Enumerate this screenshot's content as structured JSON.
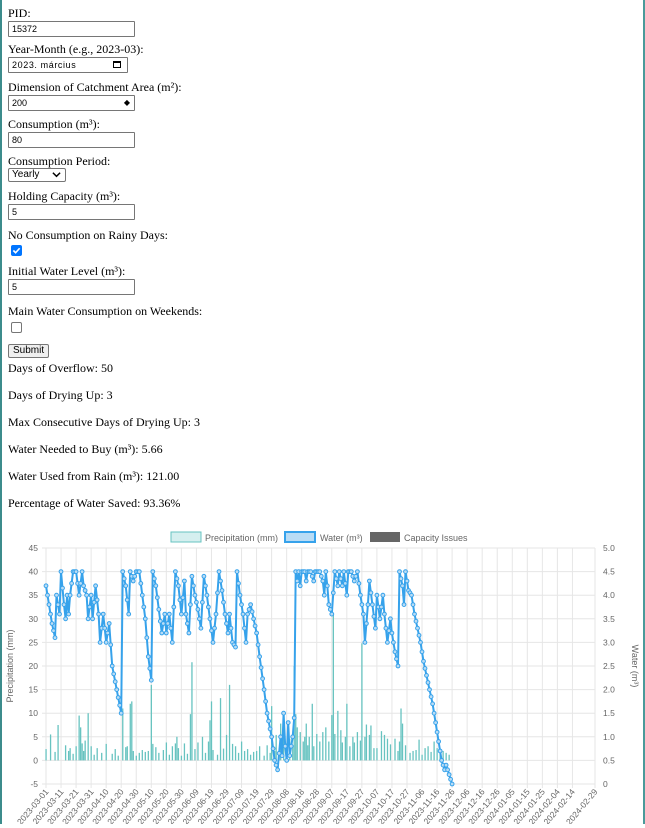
{
  "form": {
    "pid_label": "PID:",
    "pid_value": "15372",
    "yearmonth_label": "Year-Month (e.g., 2023-03):",
    "yearmonth_value": "2023. március",
    "catchment_label": "Dimension of Catchment Area (m²):",
    "catchment_value": "200",
    "consumption_label": "Consumption (m³):",
    "consumption_value": "80",
    "period_label": "Consumption Period:",
    "period_value": "Yearly",
    "holding_label": "Holding Capacity (m³):",
    "holding_value": "5",
    "rainy_label": "No Consumption on Rainy Days:",
    "rainy_checked": true,
    "initial_label": "Initial Water Level (m³):",
    "initial_value": "5",
    "weekend_label": "Main Water Consumption on Weekends:",
    "weekend_checked": false,
    "submit_label": "Submit"
  },
  "results": [
    "Days of Overflow: 50",
    "Days of Drying Up: 3",
    "Max Consecutive Days of Drying Up: 3",
    "Water Needed to Buy (m³): 5.66",
    "Water Used from Rain (m³): 121.00",
    "Percentage of Water Saved: 93.36%"
  ],
  "colors": {
    "precip_fill": "#d5efef",
    "precip_bar": "#67c3c0",
    "water_line": "#36a2eb",
    "water_fill": "#b9dcf5",
    "capacity": "#666666",
    "grid": "#e6e6e6"
  },
  "chart_data": {
    "type": "bar+line",
    "legend": [
      "Precipitation (mm)",
      "Water (m³)",
      "Capacity Issues"
    ],
    "legend_position": "top",
    "ylabel_left": "Precipitation (mm)",
    "ylabel_right": "Water (m³)",
    "ylim_left": [
      -5,
      45
    ],
    "ylim_right": [
      0,
      5
    ],
    "yticks_left": [
      "45",
      "40",
      "35",
      "30",
      "25",
      "20",
      "15",
      "10",
      "5",
      "0",
      "-5"
    ],
    "yticks_right": [
      "5.0",
      "4.5",
      "4.0",
      "3.5",
      "3.0",
      "2.5",
      "2.0",
      "1.5",
      "1.0",
      "0.5",
      "0"
    ],
    "x_start": "2023-03-01",
    "x_end": "2024-02-29",
    "xticks": [
      "2023-03-01",
      "2023-03-11",
      "2023-03-21",
      "2023-03-31",
      "2023-04-10",
      "2023-04-20",
      "2023-04-30",
      "2023-05-10",
      "2023-05-20",
      "2023-05-30",
      "2023-06-09",
      "2023-06-19",
      "2023-06-29",
      "2023-07-09",
      "2023-07-19",
      "2023-07-29",
      "2023-08-08",
      "2023-08-18",
      "2023-08-28",
      "2023-09-07",
      "2023-09-17",
      "2023-09-27",
      "2023-10-07",
      "2023-10-17",
      "2023-10-27",
      "2023-11-06",
      "2023-11-16",
      "2023-11-26",
      "2023-12-06",
      "2023-12-16",
      "2023-12-26",
      "2024-01-05",
      "2024-01-15",
      "2024-01-25",
      "2024-02-04",
      "2024-02-14",
      "2024-02-29"
    ],
    "water_keypoints": [
      [
        0,
        4.2
      ],
      [
        2,
        3.8
      ],
      [
        4,
        3.4
      ],
      [
        6,
        3.1
      ],
      [
        7,
        4.0
      ],
      [
        9,
        3.6
      ],
      [
        10,
        4.5
      ],
      [
        12,
        3.8
      ],
      [
        13,
        3.5
      ],
      [
        14,
        4.0
      ],
      [
        15,
        3.6
      ],
      [
        16,
        4.0
      ],
      [
        18,
        4.5
      ],
      [
        20,
        4.5
      ],
      [
        22,
        4.0
      ],
      [
        24,
        4.5
      ],
      [
        25,
        4.2
      ],
      [
        27,
        4.0
      ],
      [
        28,
        3.5
      ],
      [
        30,
        4.0
      ],
      [
        31,
        3.5
      ],
      [
        33,
        4.2
      ],
      [
        35,
        3.6
      ],
      [
        36,
        3.0
      ],
      [
        38,
        3.6
      ],
      [
        40,
        3.0
      ],
      [
        42,
        3.4
      ],
      [
        44,
        2.5
      ],
      [
        47,
        2.0
      ],
      [
        50,
        1.5
      ],
      [
        51,
        4.5
      ],
      [
        53,
        4.2
      ],
      [
        55,
        3.6
      ],
      [
        56,
        4.5
      ],
      [
        58,
        4.3
      ],
      [
        60,
        4.5
      ],
      [
        62,
        4.5
      ],
      [
        64,
        4.0
      ],
      [
        66,
        3.5
      ],
      [
        68,
        2.7
      ],
      [
        70,
        2.2
      ],
      [
        71,
        4.5
      ],
      [
        73,
        4.2
      ],
      [
        75,
        3.7
      ],
      [
        77,
        3.2
      ],
      [
        79,
        3.6
      ],
      [
        80,
        3.2
      ],
      [
        82,
        3.6
      ],
      [
        84,
        3.0
      ],
      [
        86,
        4.5
      ],
      [
        88,
        4.2
      ],
      [
        90,
        3.6
      ],
      [
        92,
        4.3
      ],
      [
        93,
        3.6
      ],
      [
        95,
        3.2
      ],
      [
        97,
        4.4
      ],
      [
        99,
        4.0
      ],
      [
        101,
        3.7
      ],
      [
        103,
        3.3
      ],
      [
        105,
        4.4
      ],
      [
        107,
        4.0
      ],
      [
        109,
        3.5
      ],
      [
        111,
        3.0
      ],
      [
        113,
        3.6
      ],
      [
        115,
        4.5
      ],
      [
        117,
        4.1
      ],
      [
        119,
        3.6
      ],
      [
        121,
        3.2
      ],
      [
        122,
        3.6
      ],
      [
        124,
        3.0
      ],
      [
        126,
        2.9
      ],
      [
        127,
        4.5
      ],
      [
        129,
        4.0
      ],
      [
        131,
        3.6
      ],
      [
        133,
        3.0
      ],
      [
        134,
        3.6
      ],
      [
        136,
        3.8
      ],
      [
        138,
        3.5
      ],
      [
        140,
        3.2
      ],
      [
        142,
        2.7
      ],
      [
        145,
        2.0
      ],
      [
        147,
        1.5
      ],
      [
        150,
        1.0
      ],
      [
        152,
        0.5
      ],
      [
        154,
        0.3
      ],
      [
        156,
        1.0
      ],
      [
        157,
        0.6
      ],
      [
        158,
        1.5
      ],
      [
        159,
        0.8
      ],
      [
        160,
        0.5
      ],
      [
        161,
        1.3
      ],
      [
        162,
        0.6
      ],
      [
        164,
        1.0
      ],
      [
        165,
        1.4
      ],
      [
        166,
        4.5
      ],
      [
        167,
        4.3
      ],
      [
        168,
        4.5
      ],
      [
        169,
        4.2
      ],
      [
        170,
        4.5
      ],
      [
        172,
        4.5
      ],
      [
        173,
        4.3
      ],
      [
        174,
        4.5
      ],
      [
        176,
        4.5
      ],
      [
        178,
        4.3
      ],
      [
        179,
        4.5
      ],
      [
        181,
        4.5
      ],
      [
        182,
        4.5
      ],
      [
        184,
        4.3
      ],
      [
        185,
        4.0
      ],
      [
        186,
        4.5
      ],
      [
        187,
        4.2
      ],
      [
        188,
        3.8
      ],
      [
        190,
        3.6
      ],
      [
        192,
        4.5
      ],
      [
        194,
        4.2
      ],
      [
        195,
        4.5
      ],
      [
        197,
        4.2
      ],
      [
        198,
        4.5
      ],
      [
        200,
        4.0
      ],
      [
        201,
        4.5
      ],
      [
        203,
        4.5
      ],
      [
        205,
        4.3
      ],
      [
        207,
        4.5
      ],
      [
        209,
        4.0
      ],
      [
        211,
        3.6
      ],
      [
        212,
        3.0
      ],
      [
        214,
        3.8
      ],
      [
        215,
        4.3
      ],
      [
        217,
        3.8
      ],
      [
        219,
        3.3
      ],
      [
        220,
        4.0
      ],
      [
        222,
        3.5
      ],
      [
        224,
        4.0
      ],
      [
        225,
        3.6
      ],
      [
        227,
        3.0
      ],
      [
        229,
        3.5
      ],
      [
        230,
        3.2
      ],
      [
        232,
        2.8
      ],
      [
        234,
        2.5
      ],
      [
        235,
        4.5
      ],
      [
        237,
        4.2
      ],
      [
        238,
        3.8
      ],
      [
        239,
        4.5
      ],
      [
        241,
        4.1
      ],
      [
        243,
        4.0
      ],
      [
        245,
        3.6
      ],
      [
        247,
        3.3
      ],
      [
        249,
        3.0
      ],
      [
        251,
        2.6
      ],
      [
        253,
        2.3
      ],
      [
        255,
        2.0
      ],
      [
        257,
        1.7
      ],
      [
        259,
        1.3
      ],
      [
        261,
        0.9
      ],
      [
        263,
        0.5
      ],
      [
        265,
        0.3
      ],
      [
        266,
        0.4
      ],
      [
        268,
        0.2
      ],
      [
        270,
        0.0
      ]
    ],
    "precipitation": [
      [
        0,
        2.4
      ],
      [
        3,
        5.5
      ],
      [
        6,
        1.8
      ],
      [
        8,
        7.5
      ],
      [
        13,
        3.2
      ],
      [
        15,
        2.0
      ],
      [
        16,
        2.6
      ],
      [
        18,
        1.4
      ],
      [
        20,
        3.0
      ],
      [
        22,
        9.5
      ],
      [
        23,
        7.0
      ],
      [
        24,
        3.6
      ],
      [
        25,
        2.0
      ],
      [
        26,
        4.2
      ],
      [
        28,
        10.0
      ],
      [
        30,
        3.0
      ],
      [
        32,
        1.2
      ],
      [
        34,
        2.6
      ],
      [
        37,
        1.6
      ],
      [
        40,
        3.5
      ],
      [
        44,
        1.4
      ],
      [
        46,
        2.4
      ],
      [
        48,
        1.0
      ],
      [
        51,
        11.0
      ],
      [
        53,
        2.8
      ],
      [
        54,
        3.0
      ],
      [
        56,
        12.0
      ],
      [
        57,
        12.5
      ],
      [
        58,
        2.0
      ],
      [
        60,
        1.0
      ],
      [
        62,
        1.6
      ],
      [
        64,
        2.2
      ],
      [
        66,
        1.8
      ],
      [
        68,
        2.0
      ],
      [
        70,
        16.0
      ],
      [
        71,
        3.5
      ],
      [
        73,
        2.8
      ],
      [
        75,
        1.6
      ],
      [
        78,
        2.2
      ],
      [
        80,
        3.8
      ],
      [
        82,
        1.2
      ],
      [
        84,
        3.0
      ],
      [
        86,
        3.6
      ],
      [
        87,
        5.0
      ],
      [
        88,
        2.6
      ],
      [
        90,
        1.0
      ],
      [
        92,
        3.6
      ],
      [
        94,
        1.4
      ],
      [
        96,
        9.8
      ],
      [
        97,
        20.8
      ],
      [
        99,
        2.4
      ],
      [
        101,
        3.8
      ],
      [
        104,
        5.0
      ],
      [
        106,
        1.6
      ],
      [
        108,
        4.0
      ],
      [
        109,
        8.5
      ],
      [
        110,
        12.5
      ],
      [
        111,
        2.2
      ],
      [
        114,
        1.2
      ],
      [
        116,
        13.2
      ],
      [
        118,
        2.5
      ],
      [
        120,
        5.4
      ],
      [
        122,
        16.0
      ],
      [
        124,
        3.5
      ],
      [
        126,
        3.0
      ],
      [
        128,
        1.6
      ],
      [
        130,
        4.0
      ],
      [
        132,
        2.0
      ],
      [
        134,
        2.4
      ],
      [
        136,
        1.2
      ],
      [
        138,
        1.8
      ],
      [
        140,
        2.0
      ],
      [
        142,
        3.0
      ],
      [
        145,
        1.0
      ],
      [
        147,
        3.2
      ],
      [
        149,
        1.6
      ],
      [
        150,
        11.5
      ],
      [
        152,
        2.0
      ],
      [
        153,
        5.4
      ],
      [
        155,
        1.2
      ],
      [
        156,
        7.8
      ],
      [
        158,
        10.0
      ],
      [
        160,
        3.6
      ],
      [
        162,
        4.6
      ],
      [
        164,
        2.8
      ],
      [
        165,
        20.0
      ],
      [
        166,
        9.8
      ],
      [
        167,
        7.0
      ],
      [
        169,
        6.0
      ],
      [
        171,
        4.0
      ],
      [
        172,
        5.0
      ],
      [
        173,
        7.8
      ],
      [
        174,
        3.2
      ],
      [
        175,
        5.0
      ],
      [
        177,
        12.0
      ],
      [
        178,
        3.0
      ],
      [
        180,
        5.6
      ],
      [
        182,
        4.0
      ],
      [
        184,
        6.0
      ],
      [
        186,
        7.0
      ],
      [
        188,
        4.0
      ],
      [
        190,
        9.6
      ],
      [
        191,
        31.0
      ],
      [
        192,
        5.6
      ],
      [
        194,
        10.5
      ],
      [
        196,
        6.4
      ],
      [
        197,
        3.8
      ],
      [
        199,
        5.0
      ],
      [
        200,
        12.0
      ],
      [
        202,
        3.0
      ],
      [
        204,
        5.0
      ],
      [
        205,
        3.8
      ],
      [
        207,
        6.0
      ],
      [
        209,
        4.2
      ],
      [
        210,
        24.8
      ],
      [
        212,
        5.0
      ],
      [
        213,
        7.6
      ],
      [
        215,
        5.4
      ],
      [
        216,
        7.4
      ],
      [
        218,
        2.6
      ],
      [
        220,
        2.6
      ],
      [
        223,
        6.2
      ],
      [
        225,
        5.4
      ],
      [
        227,
        4.6
      ],
      [
        229,
        3.4
      ],
      [
        232,
        4.6
      ],
      [
        234,
        2.0
      ],
      [
        235,
        4.0
      ],
      [
        236,
        11.0
      ],
      [
        237,
        7.8
      ],
      [
        239,
        3.2
      ],
      [
        242,
        1.6
      ],
      [
        244,
        2.0
      ],
      [
        246,
        2.2
      ],
      [
        248,
        4.4
      ],
      [
        250,
        1.2
      ],
      [
        252,
        2.6
      ],
      [
        254,
        3.0
      ],
      [
        256,
        1.8
      ],
      [
        258,
        4.0
      ],
      [
        260,
        2.6
      ],
      [
        262,
        1.4
      ],
      [
        264,
        2.0
      ],
      [
        266,
        1.6
      ],
      [
        268,
        1.2
      ]
    ]
  }
}
